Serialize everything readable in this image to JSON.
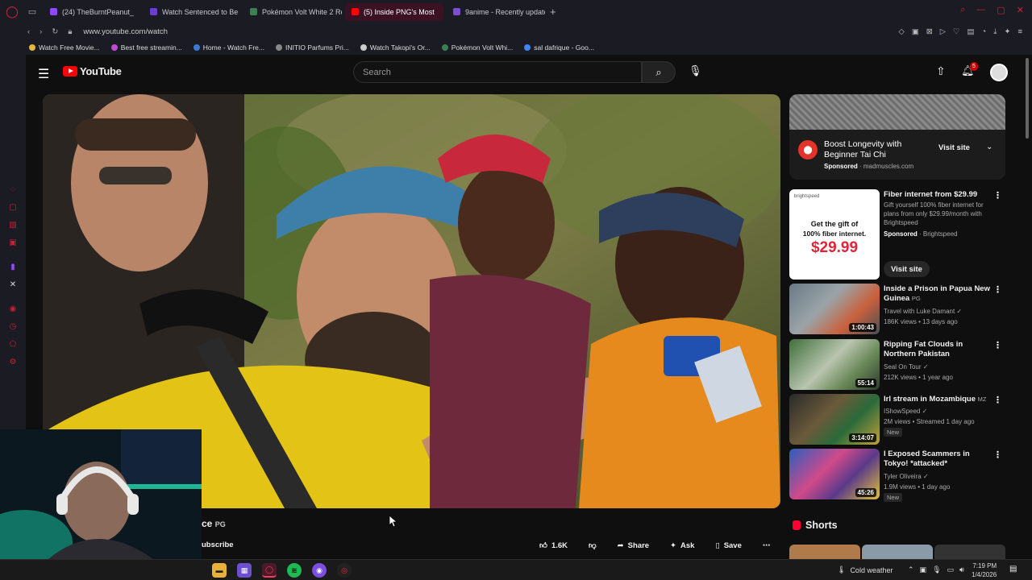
{
  "browser": {
    "tabs": [
      {
        "label": "(24) TheBurntPeanut_",
        "icon_color": "#9146ff",
        "active": false
      },
      {
        "label": "Watch Sentenced to Be a",
        "icon_color": "#6a3fd0",
        "active": false
      },
      {
        "label": "Pokémon Volt White 2 Re",
        "icon_color": "#3c7f52",
        "active": false
      },
      {
        "label": "(5) Inside PNG's Most",
        "icon_color": "#ff0000",
        "active": true
      },
      {
        "label": "9anime - Recently update",
        "icon_color": "#7b4fd0",
        "active": false
      }
    ],
    "new_tab": "+",
    "url": "www.youtube.com/watch",
    "bookmarks": [
      {
        "label": "Watch Free Movie...",
        "color": "#e2b93b"
      },
      {
        "label": "Best free streamin...",
        "color": "#c04ad0"
      },
      {
        "label": "Home - Watch Fre...",
        "color": "#3a7bd5"
      },
      {
        "label": "INITIO Parfums Pri...",
        "color": "#888888"
      },
      {
        "label": "Watch Takopi's Or...",
        "color": "#cccccc"
      },
      {
        "label": "Pokémon Volt Whi...",
        "color": "#3c7f52"
      },
      {
        "label": "sal dafrique - Goo...",
        "color": "#4285f4"
      }
    ]
  },
  "youtube": {
    "logo": "YouTube",
    "search_placeholder": "Search",
    "notifications_count": "5",
    "video_title_partial": "ce",
    "video_rating": "PG",
    "subscribe_partial": "ubscribe",
    "like_count": "1.6K",
    "share_label": "Share",
    "ask_label": "Ask",
    "save_label": "Save"
  },
  "ad": {
    "title": "Boost Longevity with Beginner Tai Chi",
    "sponsored": "Sponsored",
    "domain": "madmuscles.com",
    "cta": "Visit site"
  },
  "ad2": {
    "title": "Fiber internet from $29.99",
    "desc": "Gift yourself 100% fiber internet for plans from only $29.99/month with Brightspeed",
    "sponsored": "Sponsored",
    "advertiser": "Brightspeed",
    "cta": "Visit site",
    "thumb_brand": "brightspeed",
    "thumb_line1": "Get the gift of",
    "thumb_line2": "100% fiber internet.",
    "thumb_price": "$29.99"
  },
  "recommendations": [
    {
      "title": "Inside a Prison in Papua New Guinea",
      "rating": "PG",
      "channel": "Travel with Luke Damant",
      "meta": "186K views • 13 days ago",
      "duration": "1:00:43",
      "new": ""
    },
    {
      "title": "Ripping Fat Clouds in Northern Pakistan",
      "rating": "",
      "channel": "Seal On Tour",
      "meta": "212K views • 1 year ago",
      "duration": "55:14",
      "new": ""
    },
    {
      "title": "Irl stream in Mozambique",
      "rating": "MZ",
      "channel": "IShowSpeed",
      "meta": "2M views • Streamed 1 day ago",
      "duration": "3:14:07",
      "new": "New"
    },
    {
      "title": "I Exposed Scammers in Tokyo! *attacked*",
      "rating": "",
      "channel": "Tyler Oliveira",
      "meta": "1.9M views • 1 day ago",
      "duration": "45:26",
      "new": "New"
    }
  ],
  "shorts_label": "Shorts",
  "taskbar": {
    "weather": "Cold weather",
    "time": "7:19 PM",
    "date": "1/4/2026"
  }
}
